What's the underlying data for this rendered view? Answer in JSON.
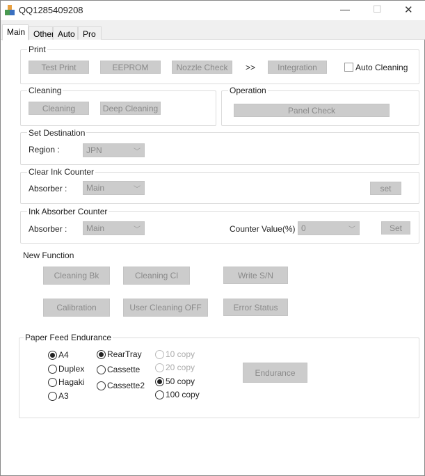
{
  "window": {
    "title": "QQ1285409208",
    "minimize": "—",
    "maximize": "☐",
    "close": "✕"
  },
  "tabs": [
    {
      "label": "Main"
    },
    {
      "label": "Other"
    },
    {
      "label": "Auto"
    },
    {
      "label": "Pro"
    }
  ],
  "print": {
    "legend": "Print",
    "test_print": "Test Print",
    "eeprom": "EEPROM",
    "nozzle_check": "Nozzle Check",
    "arrow": ">>",
    "integration": "Integration",
    "auto_cleaning": "Auto Cleaning",
    "auto_cleaning_checked": false
  },
  "cleaning": {
    "legend": "Cleaning",
    "cleaning": "Cleaning",
    "deep_cleaning": "Deep Cleaning"
  },
  "operation": {
    "legend": "Operation",
    "panel_check": "Panel Check"
  },
  "set_destination": {
    "legend": "Set Destination",
    "region_label": "Region :",
    "region_value": "JPN"
  },
  "clear_ink_counter": {
    "legend": "Clear Ink Counter",
    "absorber_label": "Absorber :",
    "absorber_value": "Main",
    "set": "set"
  },
  "ink_absorber_counter": {
    "legend": "Ink Absorber Counter",
    "absorber_label": "Absorber :",
    "absorber_value": "Main",
    "counter_label": "Counter Value(%) :",
    "counter_value": "0",
    "set": "Set"
  },
  "new_function": {
    "label": "New Function",
    "cleaning_bk": "Cleaning Bk",
    "cleaning_cl": "Cleaning Cl",
    "write_sn": "Write S/N",
    "calibration": "Calibration",
    "user_cleaning_off": "User Cleaning OFF",
    "error_status": "Error Status"
  },
  "paper_feed": {
    "legend": "Paper Feed Endurance",
    "paper": [
      {
        "label": "A4",
        "checked": true
      },
      {
        "label": "Duplex",
        "checked": false
      },
      {
        "label": "Hagaki",
        "checked": false
      },
      {
        "label": "A3",
        "checked": false
      }
    ],
    "tray": [
      {
        "label": "RearTray",
        "checked": true
      },
      {
        "label": "Cassette",
        "checked": false
      },
      {
        "label": "Cassette2",
        "checked": false
      }
    ],
    "copies": [
      {
        "label": "10 copy",
        "checked": false,
        "disabled": true
      },
      {
        "label": "20 copy",
        "checked": false,
        "disabled": true
      },
      {
        "label": "50 copy",
        "checked": true,
        "disabled": false
      },
      {
        "label": "100 copy",
        "checked": false,
        "disabled": false
      }
    ],
    "endurance": "Endurance"
  }
}
